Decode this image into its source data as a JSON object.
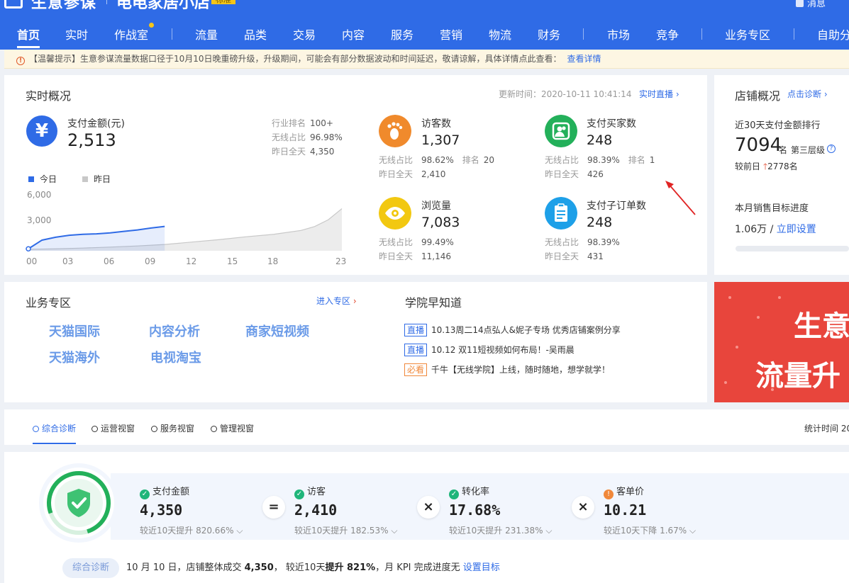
{
  "header": {
    "brand": "生意参谋",
    "shop": "电电家居小店",
    "version_badge": "标准",
    "message": "消息"
  },
  "nav": {
    "items": [
      {
        "label": "首页",
        "active": true
      },
      {
        "label": "实时"
      },
      {
        "label": "作战室",
        "dot": true
      },
      {
        "label": "流量"
      },
      {
        "label": "品类"
      },
      {
        "label": "交易"
      },
      {
        "label": "内容"
      },
      {
        "label": "服务"
      },
      {
        "label": "营销"
      },
      {
        "label": "物流"
      },
      {
        "label": "财务"
      },
      {
        "label": "市场"
      },
      {
        "label": "竞争"
      },
      {
        "label": "业务专区"
      },
      {
        "label": "自助分"
      }
    ]
  },
  "notice": {
    "icon": "warning-icon",
    "text": "【温馨提示】生意参谋流量数据口径于10月10日晚重磅升级，升级期间，可能会有部分数据波动和时间延迟，敬请谅解，具体详情点此查看：",
    "link": "查看详情"
  },
  "realtime": {
    "title": "实时概况",
    "update_time": "更新时间：2020-10-11 10:41:14",
    "live_link": "实时直播",
    "pay": {
      "icon": "yuan-icon",
      "label": "支付金额(元)",
      "value": "2,513",
      "industry_rank_label": "行业排名",
      "industry_rank": "100+",
      "wireless_label": "无线占比",
      "wireless": "96.98%",
      "yesterday_label": "昨日全天",
      "yesterday": "4,350"
    },
    "legend": {
      "today": "今日",
      "yesterday": "昨日"
    },
    "colors": {
      "today": "#2f6be6",
      "yesterday": "#c8c8c8"
    },
    "metrics": [
      {
        "icon": "footprint-icon",
        "color": "#f08a2c",
        "label": "访客数",
        "value": "1,307",
        "wireless_label": "无线占比",
        "wireless": "98.62%",
        "rank_label": "排名",
        "rank": "20",
        "yesterday_label": "昨日全天",
        "yesterday": "2,410"
      },
      {
        "icon": "buyers-icon",
        "color": "#23b05a",
        "label": "支付买家数",
        "value": "248",
        "wireless_label": "无线占比",
        "wireless": "98.39%",
        "rank_label": "排名",
        "rank": "1",
        "yesterday_label": "昨日全天",
        "yesterday": "426"
      },
      {
        "icon": "eye-icon",
        "color": "#f2c811",
        "label": "浏览量",
        "value": "7,083",
        "wireless_label": "无线占比",
        "wireless": "99.49%",
        "yesterday_label": "昨日全天",
        "yesterday": "11,146"
      },
      {
        "icon": "clipboard-icon",
        "color": "#1ea0e8",
        "label": "支付子订单数",
        "value": "248",
        "wireless_label": "无线占比",
        "wireless": "98.39%",
        "yesterday_label": "昨日全天",
        "yesterday": "431"
      }
    ]
  },
  "chart_data": {
    "type": "area",
    "title": "",
    "x_ticks": [
      "00",
      "03",
      "06",
      "09",
      "12",
      "15",
      "18",
      "23"
    ],
    "y_ticks": [
      "6,000",
      "3,000"
    ],
    "ylim": [
      0,
      6000
    ],
    "xlim": [
      0,
      23
    ],
    "series": [
      {
        "name": "今日",
        "x": [
          0,
          1,
          2,
          3,
          4,
          5,
          6,
          7,
          8,
          9,
          10
        ],
        "values": [
          200,
          1100,
          1400,
          1600,
          1700,
          1750,
          1850,
          2000,
          2150,
          2350,
          2513
        ]
      },
      {
        "name": "昨日",
        "x": [
          0,
          2,
          4,
          6,
          8,
          10,
          12,
          14,
          16,
          18,
          20,
          21,
          22,
          23
        ],
        "values": [
          150,
          200,
          280,
          380,
          500,
          650,
          900,
          1150,
          1450,
          1700,
          2100,
          2500,
          3200,
          4350
        ]
      }
    ]
  },
  "store": {
    "title": "店铺概况",
    "diagnose_link": "点击诊断",
    "rank_label": "近30天支付金额排行",
    "rank": "7094",
    "rank_unit": "名",
    "tier": "第三层级",
    "compare_label": "较前日",
    "compare": "2778名",
    "goal_label": "本月销售目标进度",
    "goal_value": "1.06万 /",
    "goal_link": "立即设置"
  },
  "business": {
    "title": "业务专区",
    "enter_link": "进入专区",
    "links": [
      "天猫国际",
      "内容分析",
      "商家短视频",
      "天猫海外",
      "电视淘宝"
    ]
  },
  "academy": {
    "title": "学院早知道",
    "news": [
      {
        "tag": "直播",
        "text": "10.13周二14点弘人&妮子专场 优秀店铺案例分享"
      },
      {
        "tag": "直播",
        "text": "10.12 双11短视频如何布局！-吴雨晨"
      },
      {
        "tag": "必看",
        "text": "千牛【无线学院】上线，随时随地，想学就学！"
      }
    ]
  },
  "banner": {
    "line1": "生意",
    "line2": "流量升"
  },
  "tabs": {
    "items": [
      "综合诊断",
      "运营视窗",
      "服务视窗",
      "管理视窗"
    ],
    "stat": "统计时间 20"
  },
  "diagnosis": {
    "formula": [
      {
        "label": "支付金额",
        "value": "4,350",
        "sub": "较近10天提升 820.66%",
        "status": "ok"
      },
      {
        "label": "访客",
        "value": "2,410",
        "sub": "较近10天提升 182.53%",
        "status": "ok"
      },
      {
        "label": "转化率",
        "value": "17.68%",
        "sub": "较近10天提升 231.38%",
        "status": "ok"
      },
      {
        "label": "客单价",
        "value": "10.21",
        "sub": "较近10天下降 1.67%",
        "status": "warn"
      }
    ],
    "operators": [
      "=",
      "×",
      "×"
    ],
    "summary": {
      "pill": "综合诊断",
      "prefix": "10 月 10 日，店铺整体成交",
      "amount": "4,350",
      "middle": "， 较近10天",
      "trend": "提升 821%",
      "suffix": "，月 KPI 完成进度无",
      "link": "设置目标"
    }
  }
}
